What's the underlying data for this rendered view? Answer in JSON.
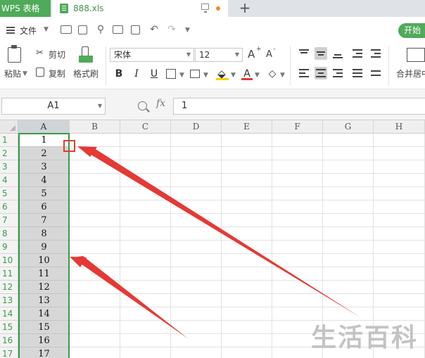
{
  "tabs": {
    "app_label": "WPS 表格",
    "file_name": "888.xls",
    "new_tab": "+"
  },
  "menu": {
    "file_label": "文件",
    "start_label": "开始"
  },
  "ribbon": {
    "paste_label": "粘贴",
    "cut_label": "剪切",
    "copy_label": "复制",
    "format_painter_label": "格式刷",
    "font_name": "宋体",
    "font_size": "12",
    "bold": "B",
    "italic": "I",
    "underline": "U",
    "grow_font": "A",
    "shrink_font": "A",
    "font_color": "A",
    "merge_center_label": "合并居中"
  },
  "formula_bar": {
    "name_box": "A1",
    "fx_label": "fx",
    "value": "1"
  },
  "sheet": {
    "columns": [
      "A",
      "B",
      "C",
      "D",
      "E",
      "F",
      "G",
      "H"
    ],
    "rows": [
      "1",
      "2",
      "3",
      "4",
      "5",
      "6",
      "7",
      "8",
      "9",
      "10",
      "11",
      "12",
      "13",
      "14",
      "15",
      "16",
      "17"
    ],
    "col_a_values": [
      "1",
      "2",
      "3",
      "4",
      "5",
      "6",
      "7",
      "8",
      "9",
      "10",
      "11",
      "12",
      "13",
      "14",
      "15",
      "16",
      "17"
    ]
  },
  "colors": {
    "accent_green": "#4faa5a",
    "selection_green": "#3a9a46",
    "annotation_red": "#e53935"
  },
  "watermark": "生活百科"
}
